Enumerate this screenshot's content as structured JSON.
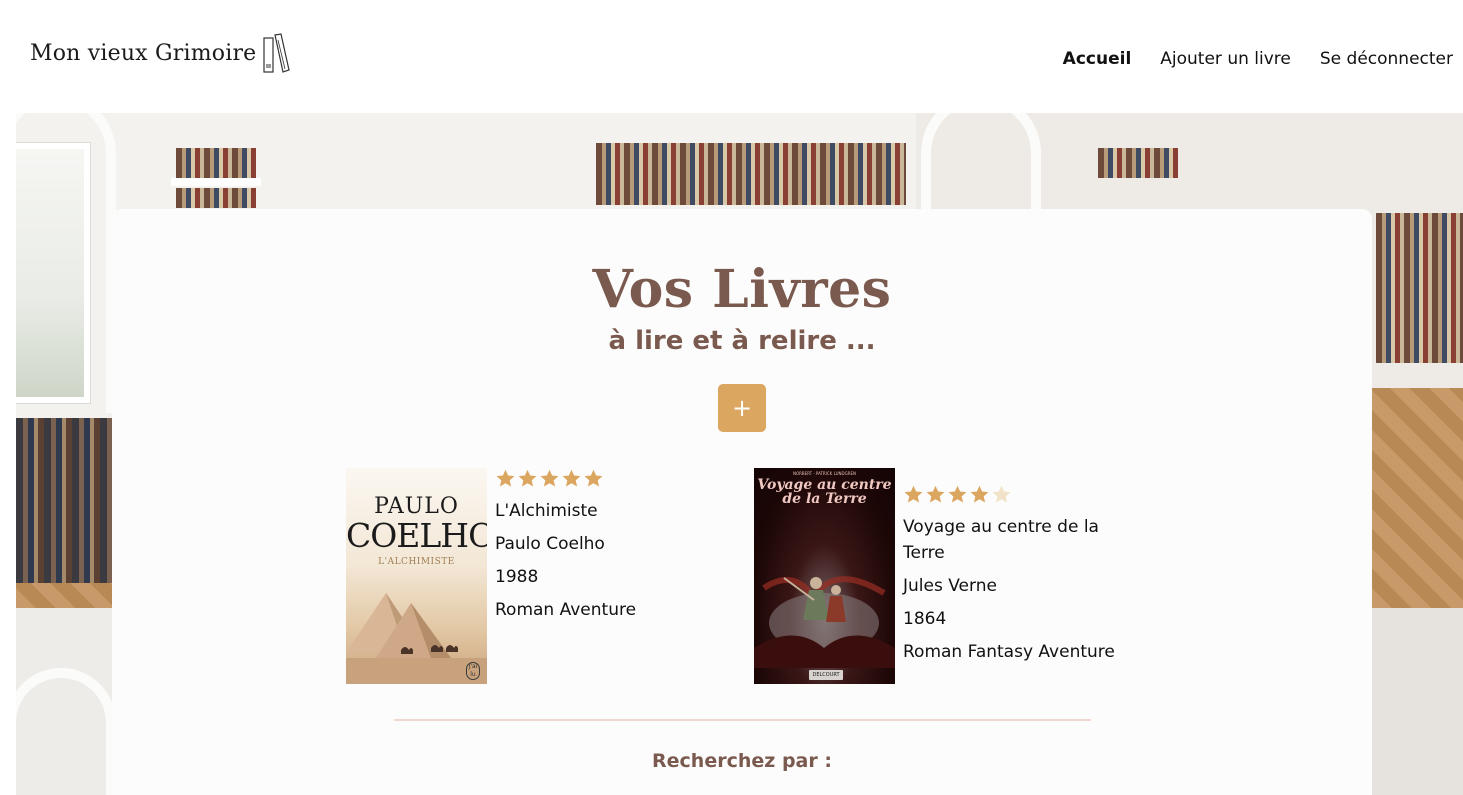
{
  "header": {
    "logo_text": "Mon vieux Grimoire",
    "logo_icon": "books-icon",
    "nav": [
      {
        "label": "Accueil",
        "active": true
      },
      {
        "label": "Ajouter un livre",
        "active": false
      },
      {
        "label": "Se déconnecter",
        "active": false
      }
    ]
  },
  "main": {
    "title": "Vos Livres",
    "subtitle": "à lire et à relire ...",
    "add_button": {
      "label": "+",
      "color": "#dba65f"
    },
    "books": [
      {
        "cover": {
          "author_line1": "PAULO",
          "author_line2": "COELHO",
          "title": "L'ALCHIMISTE",
          "publisher": "J'ai lu"
        },
        "rating": 5,
        "title": "L'Alchimiste",
        "author": "Paulo Coelho",
        "year": "1988",
        "genre": "Roman Aventure"
      },
      {
        "cover": {
          "top_text": "NORBERT · PATRICK LUNDGREN",
          "title_line1": "Voyage au centre",
          "title_line2": "de la Terre",
          "publisher": "DELCOURT"
        },
        "rating": 4,
        "title": "Voyage au centre de la Terre",
        "author": "Jules Verne",
        "year": "1864",
        "genre": "Roman Fantasy Aventure"
      }
    ],
    "search_label": "Recherchez par :"
  },
  "colors": {
    "accent": "#dba65f",
    "heading": "#7a5a4e",
    "star_filled": "#dba65f",
    "star_empty": "#f1e2c8",
    "divider": "#f1d8cf"
  }
}
